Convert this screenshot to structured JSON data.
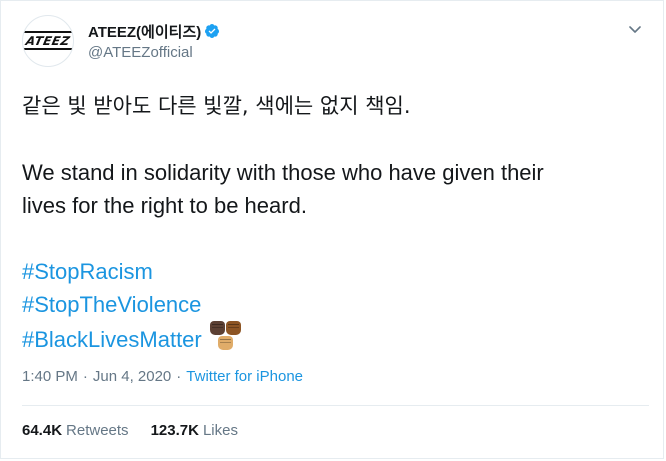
{
  "author": {
    "display_name": "ATEEZ(에이티즈)",
    "handle": "@ATEEZofficial",
    "avatar_text": "ATEEZ",
    "verified_icon": "verified-badge-icon",
    "verified_color": "#1da1f2"
  },
  "menu": {
    "icon": "chevron-down-icon"
  },
  "tweet": {
    "korean_line": "같은 빛 받아도 다른 빛깔, 색에는 없지 책임.",
    "english_line_1": "We stand in solidarity with those who have given their",
    "english_line_2": "lives for the right to be heard.",
    "hashtags": [
      "#StopRacism",
      "#StopTheViolence",
      "#BlackLivesMatter"
    ],
    "emoji": [
      "raised-fist-dark-skin-tone",
      "raised-fist-medium-dark-skin-tone",
      "raised-fist-medium-light-skin-tone"
    ]
  },
  "meta": {
    "time": "1:40 PM",
    "date": "Jun 4, 2020",
    "separator_1": "·",
    "separator_2": "·",
    "source": "Twitter for iPhone"
  },
  "stats": {
    "retweets_count": "64.4K",
    "retweets_label": "Retweets",
    "likes_count": "123.7K",
    "likes_label": "Likes"
  },
  "colors": {
    "link": "#1b95e0",
    "text": "#14171a",
    "muted": "#657786",
    "border": "#e6ecf0",
    "fist_1": "#5c4033",
    "fist_2": "#8d5524",
    "fist_3": "#e0ac69"
  }
}
